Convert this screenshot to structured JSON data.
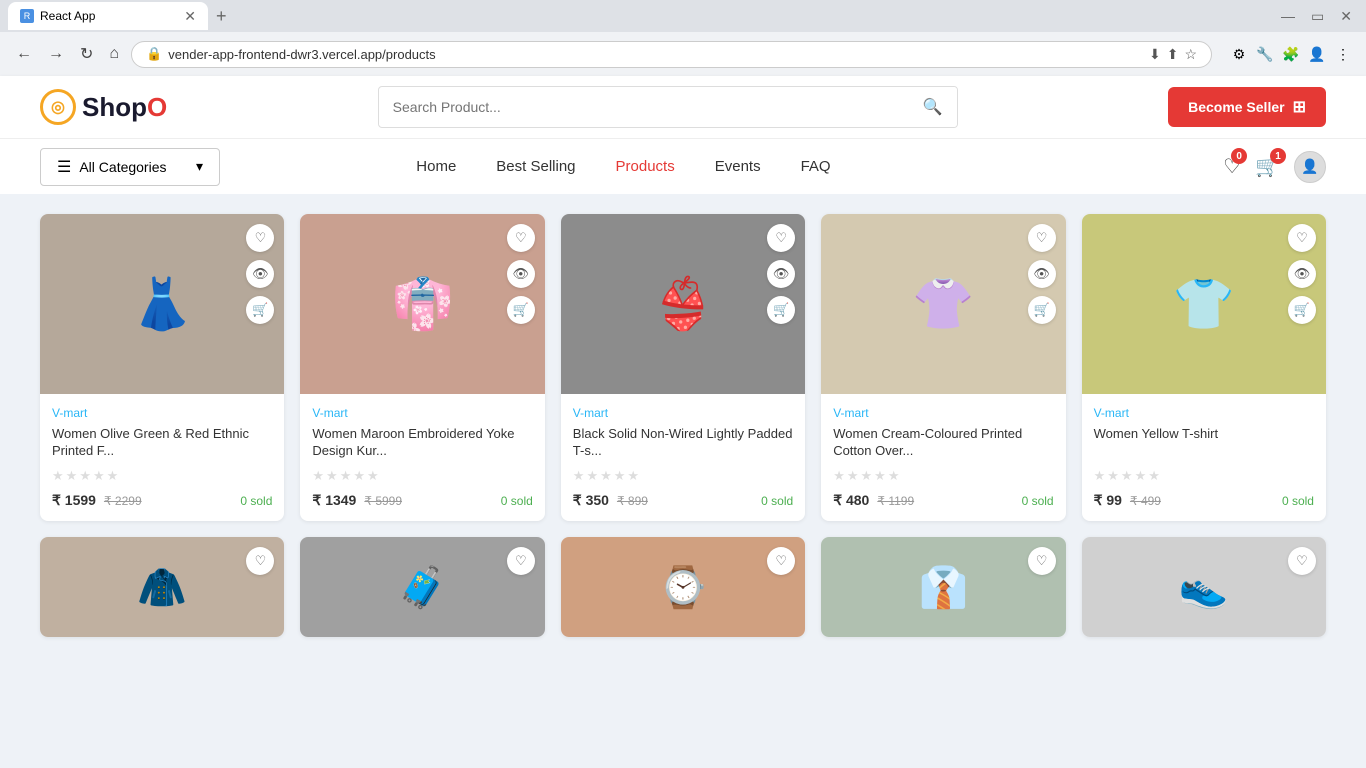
{
  "browser": {
    "tab_title": "React App",
    "url": "vender-app-frontend-dwr3.vercel.app/products",
    "nav": {
      "back": "←",
      "forward": "→",
      "refresh": "↻",
      "home": "⌂"
    }
  },
  "header": {
    "logo_text": "ShopO",
    "search_placeholder": "Search Product...",
    "become_seller_label": "Become Seller"
  },
  "navbar": {
    "categories_label": "All Categories",
    "links": [
      {
        "label": "Home",
        "active": false
      },
      {
        "label": "Best Selling",
        "active": false
      },
      {
        "label": "Products",
        "active": true
      },
      {
        "label": "Events",
        "active": false
      },
      {
        "label": "FAQ",
        "active": false
      }
    ],
    "wishlist_count": "0",
    "cart_count": "1"
  },
  "products": [
    {
      "brand": "V-mart",
      "name": "Women Olive Green & Red Ethnic Printed F...",
      "price": "₹ 1599",
      "original_price": "₹ 2299",
      "sold": "0 sold",
      "has_image": true,
      "image_color": "#b5a89a",
      "emoji": "👗"
    },
    {
      "brand": "V-mart",
      "name": "Women Maroon Embroidered Yoke Design Kur...",
      "price": "₹ 1349",
      "original_price": "₹ 5999",
      "sold": "0 sold",
      "has_image": true,
      "image_color": "#c9a090",
      "emoji": "👘"
    },
    {
      "brand": "V-mart",
      "name": "Black Solid Non-Wired Lightly Padded T-s...",
      "price": "₹ 350",
      "original_price": "₹ 899",
      "sold": "0 sold",
      "has_image": true,
      "image_color": "#8c8c8c",
      "emoji": "👙"
    },
    {
      "brand": "V-mart",
      "name": "Women Cream-Coloured Printed Cotton Over...",
      "price": "₹ 480",
      "original_price": "₹ 1199",
      "sold": "0 sold",
      "has_image": true,
      "image_color": "#d4c9b0",
      "emoji": "👚"
    },
    {
      "brand": "V-mart",
      "name": "Women Yellow T-shirt",
      "price": "₹ 99",
      "original_price": "₹ 499",
      "sold": "0 sold",
      "has_image": true,
      "image_color": "#c8c87a",
      "emoji": "👕"
    }
  ],
  "bottom_row": [
    {
      "emoji": "🧥",
      "color": "#c0b0a0"
    },
    {
      "emoji": "🧳",
      "color": "#a0a0a0"
    },
    {
      "emoji": "⌚",
      "color": "#d0a080"
    },
    {
      "emoji": "👔",
      "color": "#b0c0b0"
    },
    {
      "emoji": "👟",
      "color": "#d0d0d0"
    }
  ]
}
